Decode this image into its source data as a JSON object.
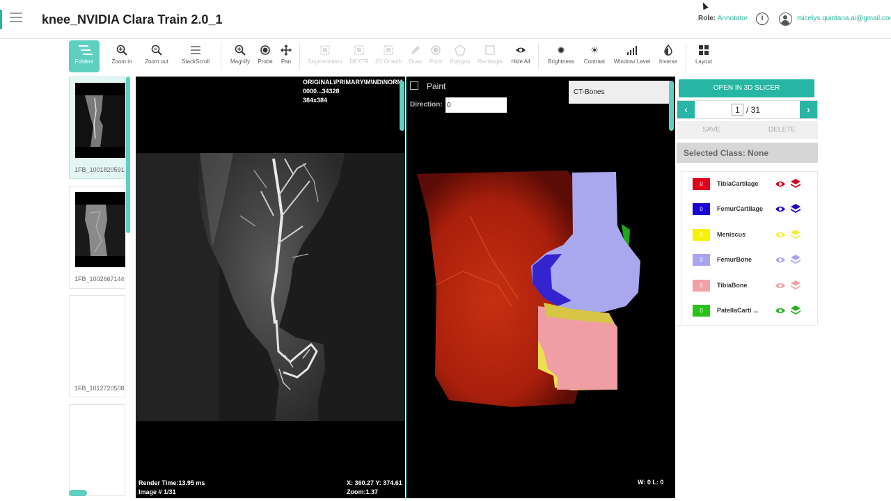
{
  "header": {
    "title": "knee_NVIDIA Clara Train 2.0_1",
    "role_label": "Role:",
    "role_value": "Annotator",
    "info": "i",
    "email": "micelys.quintana.ai@gmail.com"
  },
  "toolbar": {
    "folders": "Folders",
    "zoom_in": "Zoom in",
    "zoom_out": "Zoom out",
    "stack_scroll": "StackScroll",
    "magnify": "Magnify",
    "probe": "Probe",
    "pan": "Pan",
    "segmentation": "Segmentation",
    "dextr": "DEXTR",
    "growth_2d": "2D Growth",
    "draw": "Draw",
    "point": "Point",
    "polygon": "Polygon",
    "rectangle": "Rectangle",
    "hide_all": "Hide All",
    "brightness": "Brightness",
    "contrast": "Contrast",
    "window_level": "Window/ Level",
    "inverse": "Inverse",
    "layout": "Layout"
  },
  "thumbnails": [
    {
      "label": "1FB_1001820591"
    },
    {
      "label": "1FB_1002667144"
    },
    {
      "label": "1FB_1012720508"
    },
    {
      "label": ""
    }
  ],
  "viewport_left": {
    "series_desc": "ORIGINAL\\PRIMARY\\M\\ND\\NORM",
    "series_id": "0000...34328",
    "dimensions": "384x384",
    "render_time": "Render Time:13.95 ms",
    "image_index": "Image # 1/31",
    "coords": "X: 360.27 Y: 374.61",
    "zoom": "Zoom:1.37"
  },
  "viewport_right": {
    "paint_label": "Paint",
    "direction_label": "Direction:",
    "direction_value": "0",
    "preset": "CT-Bones",
    "window_level": "W: 0 L: 0"
  },
  "panel": {
    "open_slicer": "OPEN IN 3D SLICER",
    "page_current": "1",
    "page_total": "/ 31",
    "prev": "‹",
    "next": "›",
    "save": "SAVE",
    "delete": "DELETE",
    "selected_class": "Selected Class: None"
  },
  "labels": [
    {
      "name": "TibiaCartilage",
      "count": "0",
      "color": "#e0001b",
      "eye_color": "#d6001c",
      "layer_color": "#d6001c"
    },
    {
      "name": "FemurCartilage",
      "count": "0",
      "color": "#1a00d4",
      "eye_color": "#1a00c8",
      "layer_color": "#1a00c8"
    },
    {
      "name": "Meniscus",
      "count": "0",
      "color": "#f5f300",
      "eye_color": "#f0ee3a",
      "layer_color": "#f0ee3a"
    },
    {
      "name": "FemurBone",
      "count": "0",
      "color": "#a9a4f2",
      "eye_color": "#a9a4f2",
      "layer_color": "#a9a4f2"
    },
    {
      "name": "TibiaBone",
      "count": "0",
      "color": "#f0a2a8",
      "eye_color": "#f0a2a8",
      "layer_color": "#f0a2a8"
    },
    {
      "name": "PatellaCarti ...",
      "count": "0",
      "color": "#29c21a",
      "eye_color": "#23b11a",
      "layer_color": "#23b11a"
    }
  ]
}
